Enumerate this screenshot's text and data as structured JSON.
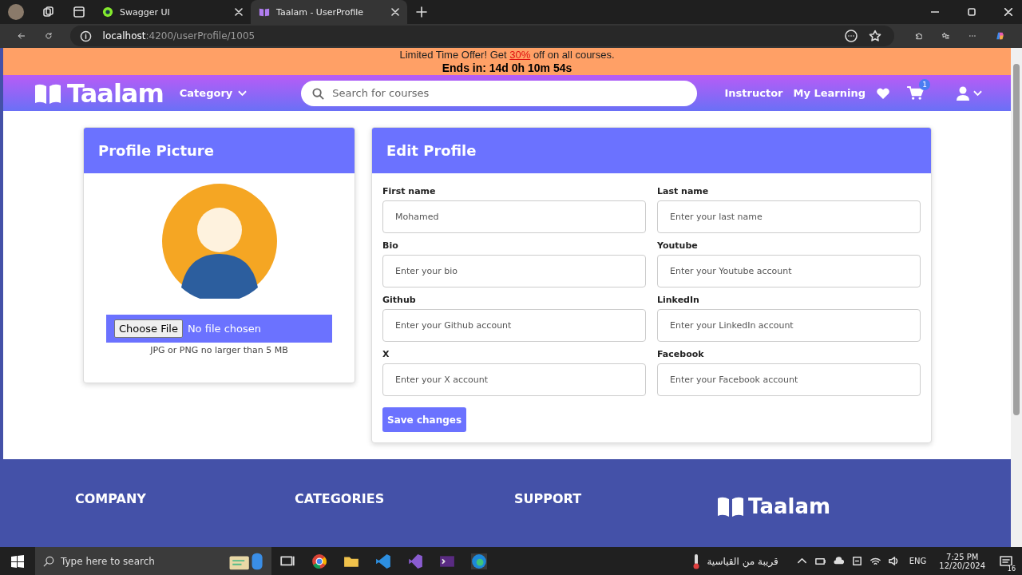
{
  "browser": {
    "tabs": [
      {
        "title": "Swagger UI",
        "selected": false
      },
      {
        "title": "Taalam - UserProfile",
        "selected": true
      }
    ],
    "url_host": "localhost",
    "url_path": ":4200/userProfile/1005"
  },
  "banner": {
    "before": "Limited Time Offer! Get ",
    "link": "30%",
    "after": " off on all courses.",
    "countdown": "Ends in: 14d 0h 10m 54s"
  },
  "navbar": {
    "logo": "Taalam",
    "category": "Category",
    "search_placeholder": "Search for courses",
    "links": [
      "Instructor",
      "My Learning"
    ],
    "cart_count": "1"
  },
  "profile_picture": {
    "title": "Profile Picture",
    "file_button": "Choose File",
    "file_status": "No file chosen",
    "hint": "JPG or PNG no larger than 5 MB"
  },
  "edit_profile": {
    "title": "Edit Profile",
    "fields": [
      {
        "label": "First name",
        "value": "Mohamed"
      },
      {
        "label": "Last name",
        "placeholder": "Enter your last name"
      },
      {
        "label": "Bio",
        "placeholder": "Enter your bio"
      },
      {
        "label": "Youtube",
        "placeholder": "Enter your Youtube account"
      },
      {
        "label": "Github",
        "placeholder": "Enter your Github account"
      },
      {
        "label": "LinkedIn",
        "placeholder": "Enter your LinkedIn account"
      },
      {
        "label": "X",
        "placeholder": "Enter your X account"
      },
      {
        "label": "Facebook",
        "placeholder": "Enter your Facebook account"
      }
    ],
    "save": "Save changes"
  },
  "footer": {
    "headings": [
      "COMPANY",
      "CATEGORIES",
      "SUPPORT"
    ],
    "logo": "Taalam"
  },
  "taskbar": {
    "search_placeholder": "Type here to search",
    "weather": "قريبة من القياسية",
    "language": "ENG",
    "time": "7:25 PM",
    "date": "12/20/2024",
    "notifications": "16"
  }
}
